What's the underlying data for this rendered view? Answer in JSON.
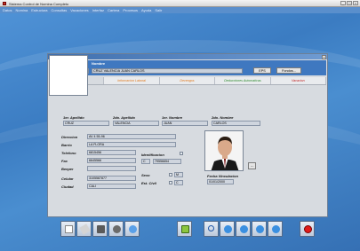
{
  "window": {
    "title": "Sistema Control de Nomina Completo",
    "menu": [
      "Datos",
      "Nomina",
      "Estructura",
      "Consultas",
      "Vacaciones",
      "Interfaz",
      "Cartera",
      "Procesos",
      "Ayuda",
      "Salir"
    ]
  },
  "dialog": {
    "title": "Tabla de Empleados",
    "codigo_label": "Codigo",
    "nombre_label": "Nombre",
    "codigo_value": "79556654",
    "nombre_value": "CRUZ VALENCIA JUAN CARLOS",
    "eps_button": "EPS",
    "fondos_button": "Fondos..."
  },
  "tabs": [
    "Datos Basicos",
    "Informacion Laboral",
    "Devengos",
    "Deducciones Automaticas",
    "Vacacion"
  ],
  "form": {
    "apellido1_label": "1er. Apellido",
    "apellido2_label": "2do. Apellido",
    "nombre1_label": "1er. Nombre",
    "nombre2_label": "2do. Nombre",
    "apellido1": "CRUZ",
    "apellido2": "VALENCIA",
    "nombre1": "JUAN",
    "nombre2": "CARLOS",
    "direccion_label": "Direccion",
    "direccion": "AV 4 55-96",
    "barrio_label": "Barrio",
    "barrio": "LA FLORA",
    "telefono_label": "Telefono",
    "telefono": "6815456",
    "fax_label": "Fax",
    "fax": "6645566",
    "beeper_label": "Beeper",
    "beeper": "",
    "celular_label": "Celular",
    "celular": "3105587877",
    "ciudad_label": "Ciudad",
    "ciudad": "CALI",
    "identificacion_label": "Identificacion",
    "id_tipo": "C",
    "id_numero": "79556654",
    "sexo_label": "Sexo",
    "sexo": "M",
    "estcivil_label": "Est. Civil",
    "estcivil": "C",
    "fecha_vinc_label": "Fecha Vinculacion",
    "fecha_vinc": "01/01/2000"
  },
  "colors": {
    "accent": "#3f78c0",
    "tab_active": "#1f4fa0",
    "tab_orange": "#e07a1f",
    "tab_green": "#2e8b2e",
    "tab_red": "#c02020"
  }
}
